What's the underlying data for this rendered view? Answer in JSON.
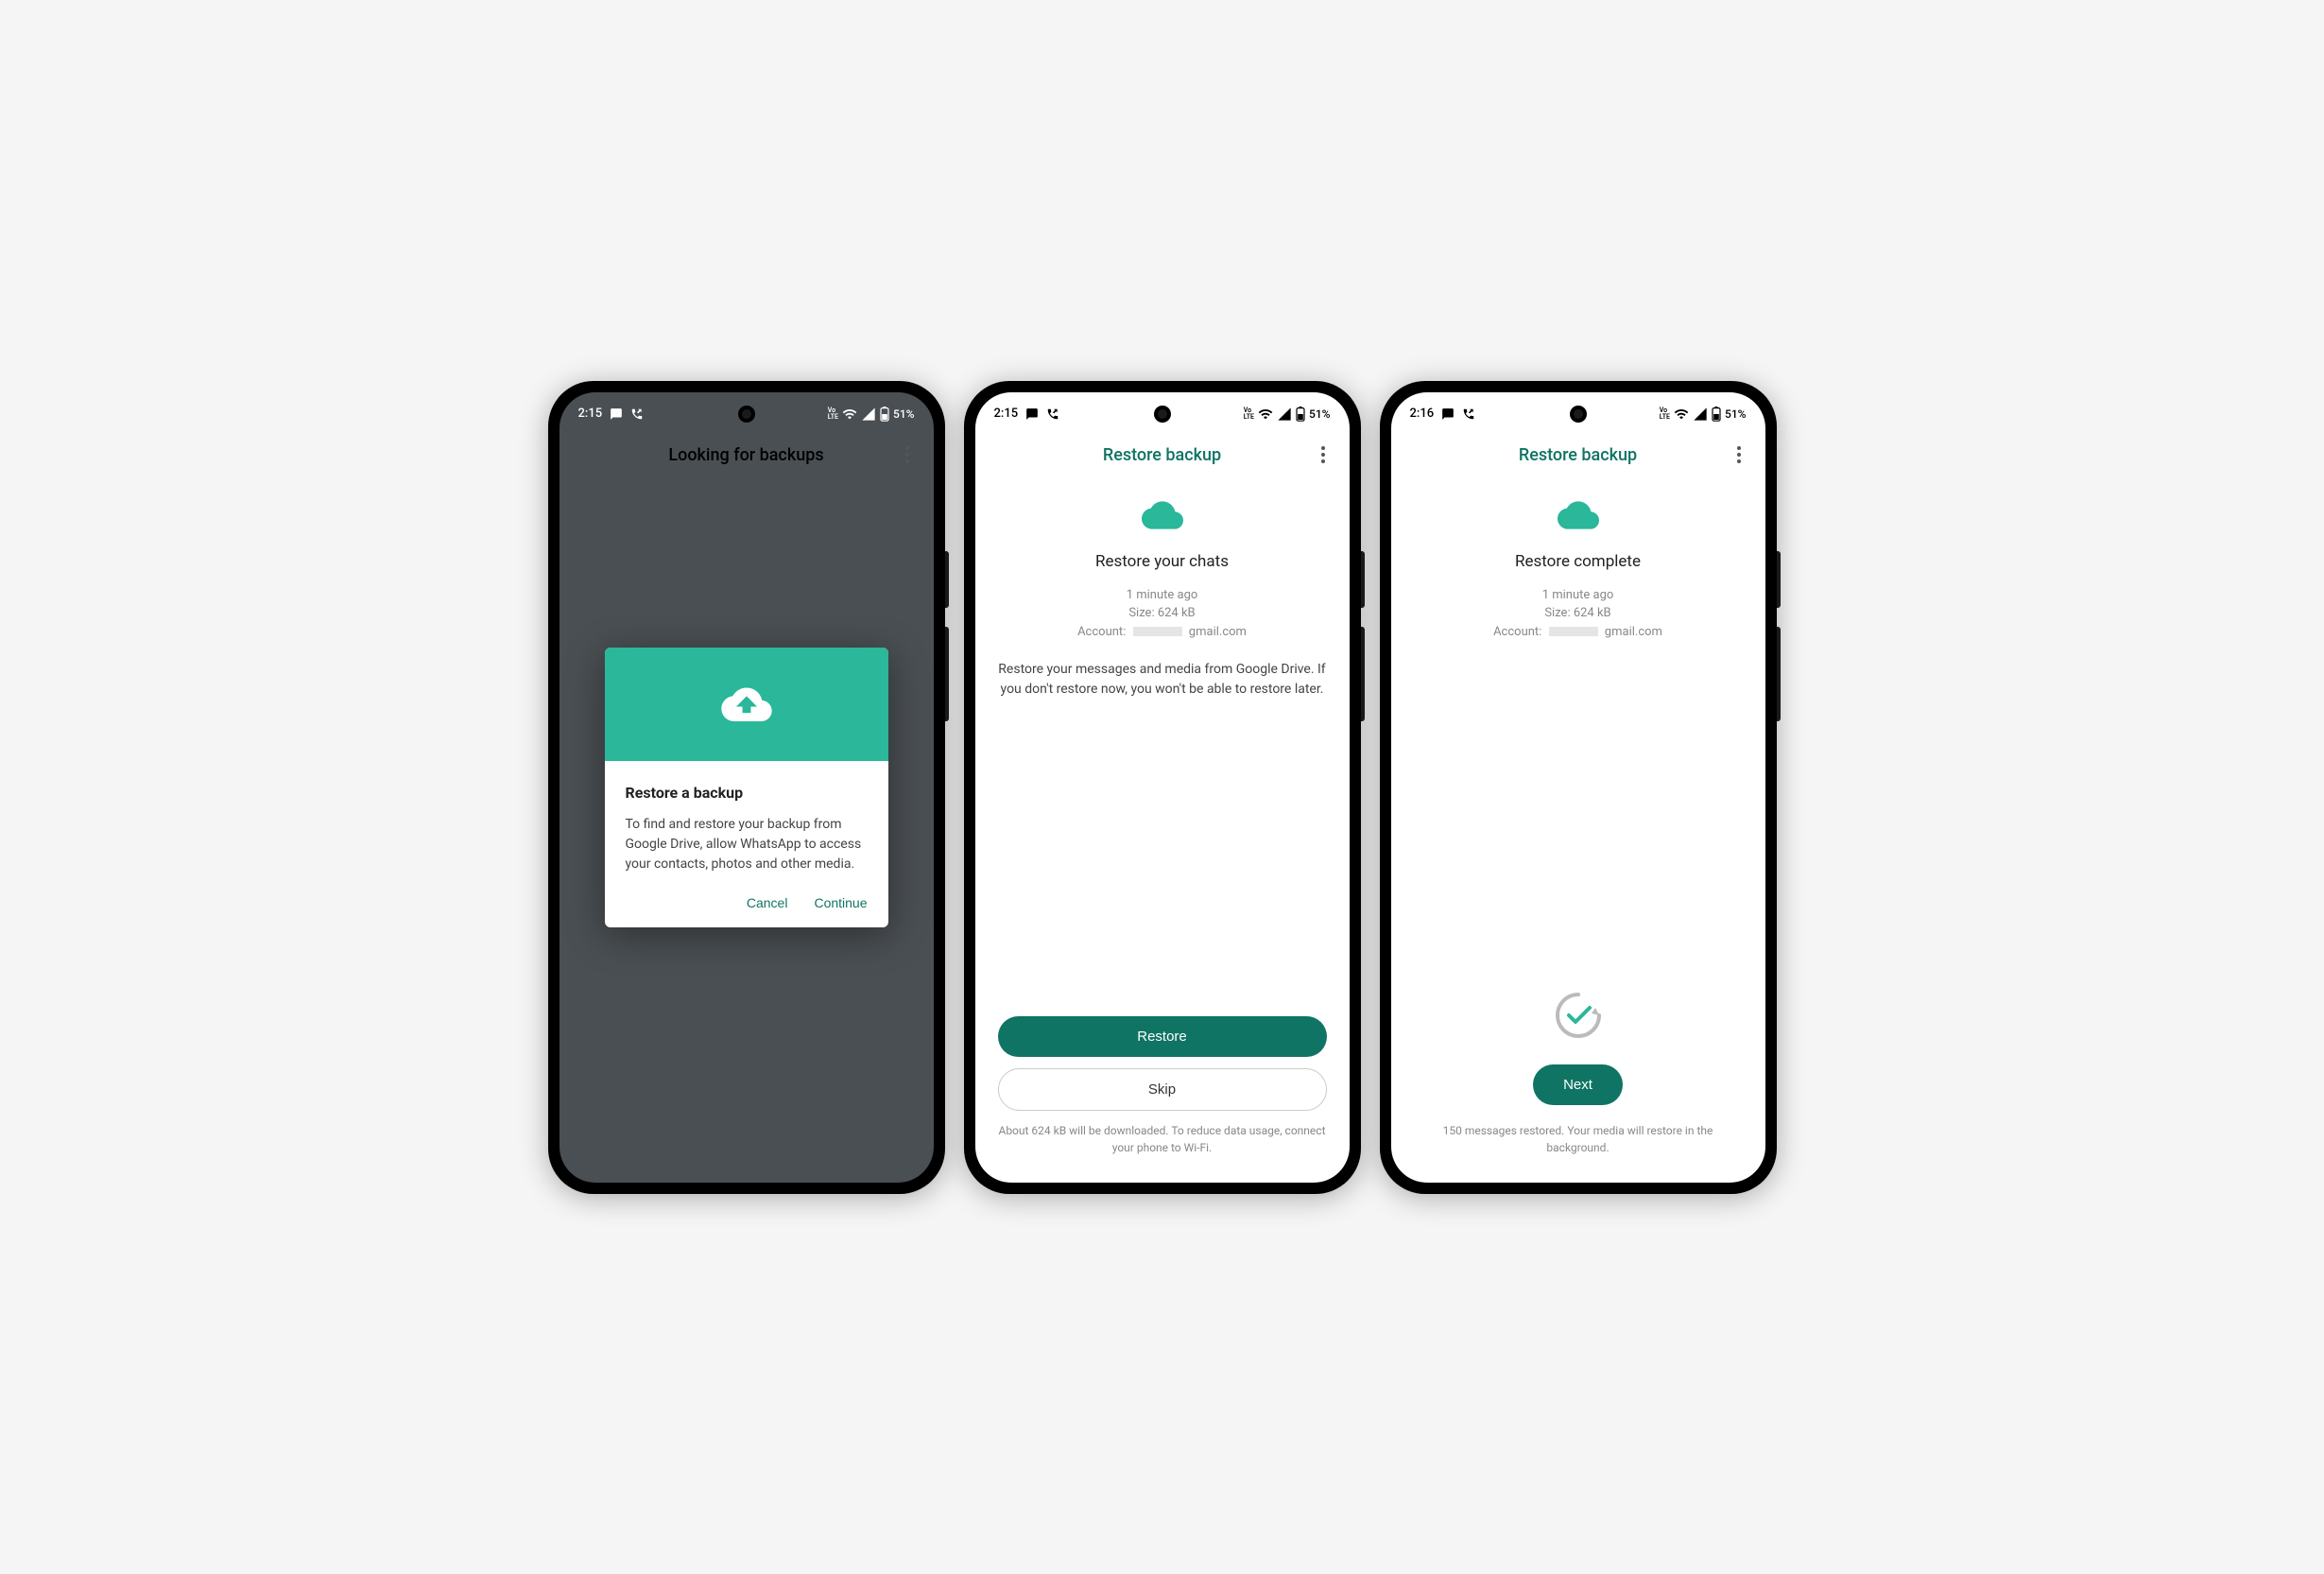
{
  "status": {
    "time_a": "2:15",
    "time_b": "2:15",
    "time_c": "2:16",
    "lte_label": "Vo\nLTE",
    "battery": "51%"
  },
  "screen1": {
    "title": "Looking for backups",
    "modal": {
      "title": "Restore a backup",
      "body": "To find and restore your backup from Google Drive, allow WhatsApp to access your contacts, photos and other media.",
      "cancel": "Cancel",
      "continue": "Continue"
    }
  },
  "screen2": {
    "title": "Restore backup",
    "heading": "Restore your chats",
    "meta_time": "1 minute ago",
    "meta_size": "Size: 624 kB",
    "meta_account_prefix": "Account:",
    "meta_account_suffix": "gmail.com",
    "description": "Restore your messages and media from Google Drive. If you don't restore now, you won't be able to restore later.",
    "restore_btn": "Restore",
    "skip_btn": "Skip",
    "footer": "About 624 kB will be downloaded. To reduce data usage, connect your phone to Wi-Fi."
  },
  "screen3": {
    "title": "Restore backup",
    "heading": "Restore complete",
    "meta_time": "1 minute ago",
    "meta_size": "Size: 624 kB",
    "meta_account_prefix": "Account:",
    "meta_account_suffix": "gmail.com",
    "next_btn": "Next",
    "footer": "150 messages restored. Your media will restore in the background."
  },
  "colors": {
    "accent": "#0f7463",
    "teal_header": "#2ab79a"
  }
}
